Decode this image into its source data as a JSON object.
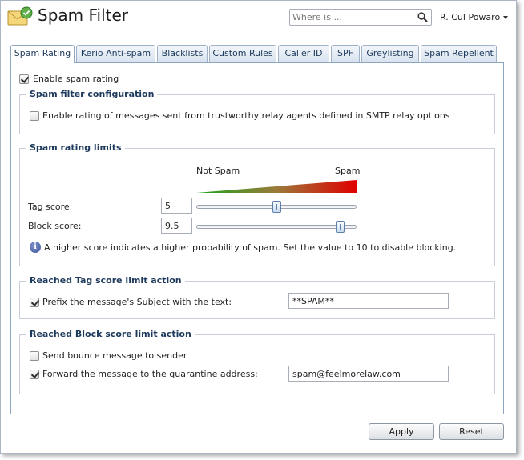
{
  "header": {
    "title": "Spam Filter",
    "search_placeholder": "Where is ...",
    "user_name": "R. Cul Powaro"
  },
  "tabs": [
    {
      "label": "Spam Rating",
      "active": true
    },
    {
      "label": "Kerio Anti-spam",
      "active": false
    },
    {
      "label": "Blacklists",
      "active": false
    },
    {
      "label": "Custom Rules",
      "active": false
    },
    {
      "label": "Caller ID",
      "active": false
    },
    {
      "label": "SPF",
      "active": false
    },
    {
      "label": "Greylisting",
      "active": false
    },
    {
      "label": "Spam Repellent",
      "active": false
    }
  ],
  "enable_rating": {
    "label": "Enable spam rating",
    "checked": true
  },
  "filter_config": {
    "legend": "Spam filter configuration",
    "trust_relay": {
      "label": "Enable rating of messages sent from trustworthy relay agents defined in SMTP relay options",
      "checked": false
    }
  },
  "rating_limits": {
    "legend": "Spam rating limits",
    "scale_low": "Not Spam",
    "scale_high": "Spam",
    "tag_score": {
      "label": "Tag score:",
      "value": "5",
      "slider_value": 5
    },
    "block_score": {
      "label": "Block score:",
      "value": "9.5",
      "slider_value": 9.5
    },
    "slider_max": 10,
    "info": "A higher score indicates a higher probability of spam. Set the value to 10 to disable blocking."
  },
  "tag_action": {
    "legend": "Reached Tag score limit action",
    "prefix": {
      "label": "Prefix the message's Subject with the text:",
      "checked": true,
      "value": "**SPAM**"
    }
  },
  "block_action": {
    "legend": "Reached Block score limit action",
    "bounce": {
      "label": "Send bounce message to sender",
      "checked": false
    },
    "forward": {
      "label": "Forward the message to the quarantine address:",
      "checked": true,
      "value": "spam@feelmorelaw.com"
    }
  },
  "footer": {
    "apply_label": "Apply",
    "reset_label": "Reset"
  },
  "colors": {
    "accent": "#1d3a5c",
    "gradient_low": "#1aa31a",
    "gradient_high": "#e00000"
  }
}
